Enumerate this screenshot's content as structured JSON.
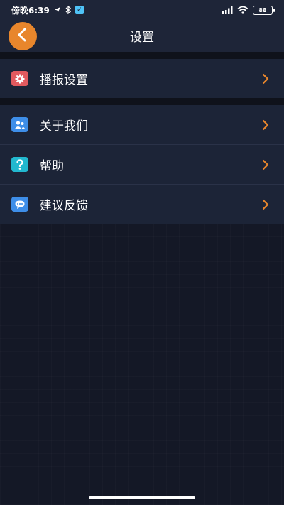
{
  "status_bar": {
    "time": "傍晚6:39",
    "battery": "88",
    "icons": [
      "navigation-icon",
      "bluetooth-icon",
      "check-badge-icon",
      "signal-icon",
      "wifi-icon",
      "battery-icon"
    ]
  },
  "header": {
    "title": "设置",
    "back_icon": "chevron-left-icon"
  },
  "colors": {
    "accent": "#e8862c",
    "header_bg": "#1e2538",
    "row_bg": "#1c2437",
    "page_bg": "#141826"
  },
  "groups": [
    {
      "items": [
        {
          "label": "播报设置",
          "icon": "gear-icon",
          "icon_color": "#e25a5f"
        }
      ]
    },
    {
      "items": [
        {
          "label": "关于我们",
          "icon": "users-icon",
          "icon_color": "#3e8ee8"
        },
        {
          "label": "帮助",
          "icon": "help-icon",
          "icon_color": "#22b8cf"
        },
        {
          "label": "建议反馈",
          "icon": "chat-icon",
          "icon_color": "#3e8ee8"
        }
      ]
    }
  ]
}
